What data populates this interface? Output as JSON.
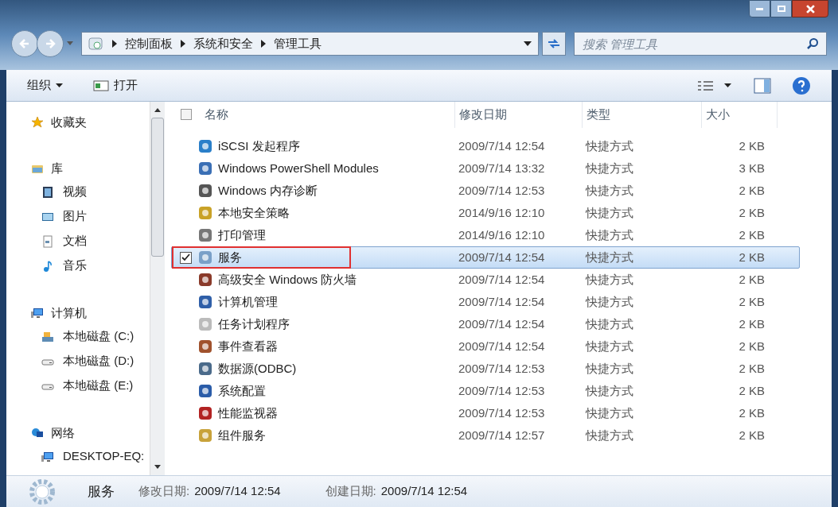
{
  "window": {
    "breadcrumb": [
      "控制面板",
      "系统和安全",
      "管理工具"
    ],
    "search": {
      "placeholder": "搜索 管理工具"
    }
  },
  "toolbar": {
    "organize": "组织",
    "open": "打开"
  },
  "sidebar": {
    "groups": [
      {
        "label": "收藏夹",
        "kind": "favorites"
      },
      {
        "label": "库",
        "kind": "library",
        "children": [
          {
            "label": "视频",
            "kind": "video"
          },
          {
            "label": "图片",
            "kind": "pictures"
          },
          {
            "label": "文档",
            "kind": "documents"
          },
          {
            "label": "音乐",
            "kind": "music"
          }
        ]
      },
      {
        "label": "计算机",
        "kind": "computer",
        "children": [
          {
            "label": "本地磁盘 (C:)",
            "kind": "system-drive"
          },
          {
            "label": "本地磁盘 (D:)",
            "kind": "drive"
          },
          {
            "label": "本地磁盘 (E:)",
            "kind": "drive"
          }
        ]
      },
      {
        "label": "网络",
        "kind": "network",
        "children": [
          {
            "label": "DESKTOP-EQ:",
            "kind": "computer"
          }
        ]
      }
    ]
  },
  "table": {
    "select_all_checked": false,
    "columns": [
      "名称",
      "修改日期",
      "类型",
      "大小"
    ],
    "rows": [
      {
        "name": "iSCSI 发起程序",
        "date": "2009/7/14 12:54",
        "type": "快捷方式",
        "size": "2 KB",
        "selected": false,
        "checked": false,
        "highlighted": false
      },
      {
        "name": "Windows PowerShell Modules",
        "date": "2009/7/14 13:32",
        "type": "快捷方式",
        "size": "3 KB",
        "selected": false,
        "checked": false,
        "highlighted": false
      },
      {
        "name": "Windows 内存诊断",
        "date": "2009/7/14 12:53",
        "type": "快捷方式",
        "size": "2 KB",
        "selected": false,
        "checked": false,
        "highlighted": false
      },
      {
        "name": "本地安全策略",
        "date": "2014/9/16 12:10",
        "type": "快捷方式",
        "size": "2 KB",
        "selected": false,
        "checked": false,
        "highlighted": false
      },
      {
        "name": "打印管理",
        "date": "2014/9/16 12:10",
        "type": "快捷方式",
        "size": "2 KB",
        "selected": false,
        "checked": false,
        "highlighted": false
      },
      {
        "name": "服务",
        "date": "2009/7/14 12:54",
        "type": "快捷方式",
        "size": "2 KB",
        "selected": true,
        "checked": true,
        "highlighted": true
      },
      {
        "name": "高级安全 Windows 防火墙",
        "date": "2009/7/14 12:54",
        "type": "快捷方式",
        "size": "2 KB",
        "selected": false,
        "checked": false,
        "highlighted": false
      },
      {
        "name": "计算机管理",
        "date": "2009/7/14 12:54",
        "type": "快捷方式",
        "size": "2 KB",
        "selected": false,
        "checked": false,
        "highlighted": false
      },
      {
        "name": "任务计划程序",
        "date": "2009/7/14 12:54",
        "type": "快捷方式",
        "size": "2 KB",
        "selected": false,
        "checked": false,
        "highlighted": false
      },
      {
        "name": "事件查看器",
        "date": "2009/7/14 12:54",
        "type": "快捷方式",
        "size": "2 KB",
        "selected": false,
        "checked": false,
        "highlighted": false
      },
      {
        "name": "数据源(ODBC)",
        "date": "2009/7/14 12:53",
        "type": "快捷方式",
        "size": "2 KB",
        "selected": false,
        "checked": false,
        "highlighted": false
      },
      {
        "name": "系统配置",
        "date": "2009/7/14 12:53",
        "type": "快捷方式",
        "size": "2 KB",
        "selected": false,
        "checked": false,
        "highlighted": false
      },
      {
        "name": "性能监视器",
        "date": "2009/7/14 12:53",
        "type": "快捷方式",
        "size": "2 KB",
        "selected": false,
        "checked": false,
        "highlighted": false
      },
      {
        "name": "组件服务",
        "date": "2009/7/14 12:57",
        "type": "快捷方式",
        "size": "2 KB",
        "selected": false,
        "checked": false,
        "highlighted": false
      }
    ]
  },
  "details": {
    "name": "服务",
    "fields": [
      {
        "label": "修改日期:",
        "value": "2009/7/14 12:54"
      },
      {
        "label": "创建日期:",
        "value": "2009/7/14 12:54"
      }
    ]
  }
}
